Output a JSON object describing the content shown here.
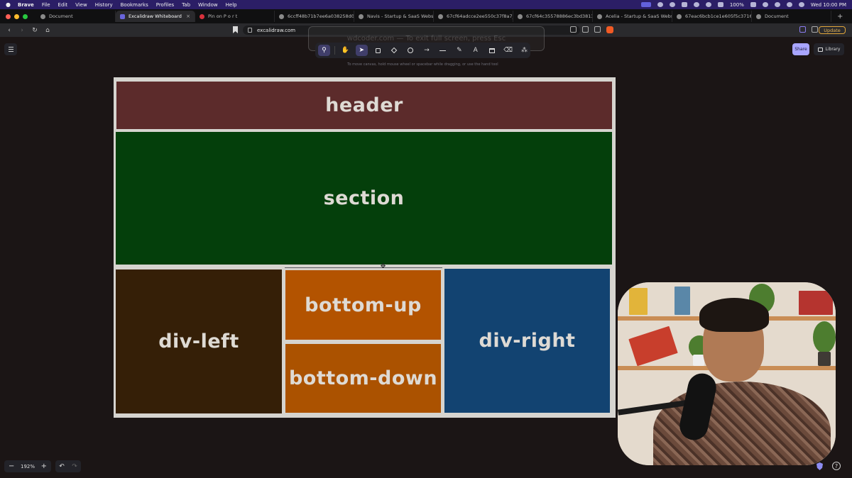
{
  "menubar": {
    "app": "Brave",
    "items": [
      "File",
      "Edit",
      "View",
      "History",
      "Bookmarks",
      "Profiles",
      "Tab",
      "Window",
      "Help"
    ],
    "battery": "100%",
    "clock": "Wed 10:00 PM"
  },
  "tabs": [
    {
      "title": "Document",
      "icon": "globe-icon"
    },
    {
      "title": "Excalidraw Whiteboard",
      "icon": "excalidraw-icon",
      "active": true
    },
    {
      "title": "Pin on P o r t",
      "icon": "pinterest-icon"
    },
    {
      "title": "6ccff48b71b7ee6a038258d083",
      "icon": "globe-icon"
    },
    {
      "title": "Navis - Startup & SaaS Website",
      "icon": "globe-icon"
    },
    {
      "title": "67cf64adcce2ee550c37f8a7_Te",
      "icon": "globe-icon"
    },
    {
      "title": "67cf64c35578886ec3bd3813_A",
      "icon": "globe-icon"
    },
    {
      "title": "Acelia - Startup & SaaS Website",
      "icon": "globe-icon"
    },
    {
      "title": "67eac6bcb1ce1e605f5c3716_Te",
      "icon": "globe-icon"
    },
    {
      "title": "Document",
      "icon": "globe-icon"
    }
  ],
  "address_bar": {
    "url": "excalidraw.com",
    "update_label": "Update"
  },
  "fullscreen_hint": "wdcoder.com — To exit full screen, press  Esc",
  "excalidraw": {
    "toolbar_tools": [
      "lock-icon",
      "hand-icon",
      "selection-icon",
      "rectangle-icon",
      "diamond-icon",
      "ellipse-icon",
      "arrow-icon",
      "line-icon",
      "pencil-icon",
      "text-icon",
      "frame-icon",
      "eraser-icon",
      "more-tools-icon"
    ],
    "canvas_hint": "To move canvas, hold mouse wheel or spacebar while dragging, or use the hand tool",
    "share_label": "Share",
    "library_label": "Library",
    "zoom": "192%"
  },
  "drawing": {
    "header": "header",
    "section": "section",
    "div_left": "div-left",
    "bottom_up": "bottom-up",
    "bottom_down": "bottom-down",
    "div_right": "div-right"
  },
  "colors": {
    "header": "#5c2b2b",
    "section": "#043f0b",
    "div_left": "#351f07",
    "bottom_up": "#b35300",
    "bottom_down": "#ab5200",
    "div_right": "#124371",
    "accent": "#a8a5ff"
  }
}
